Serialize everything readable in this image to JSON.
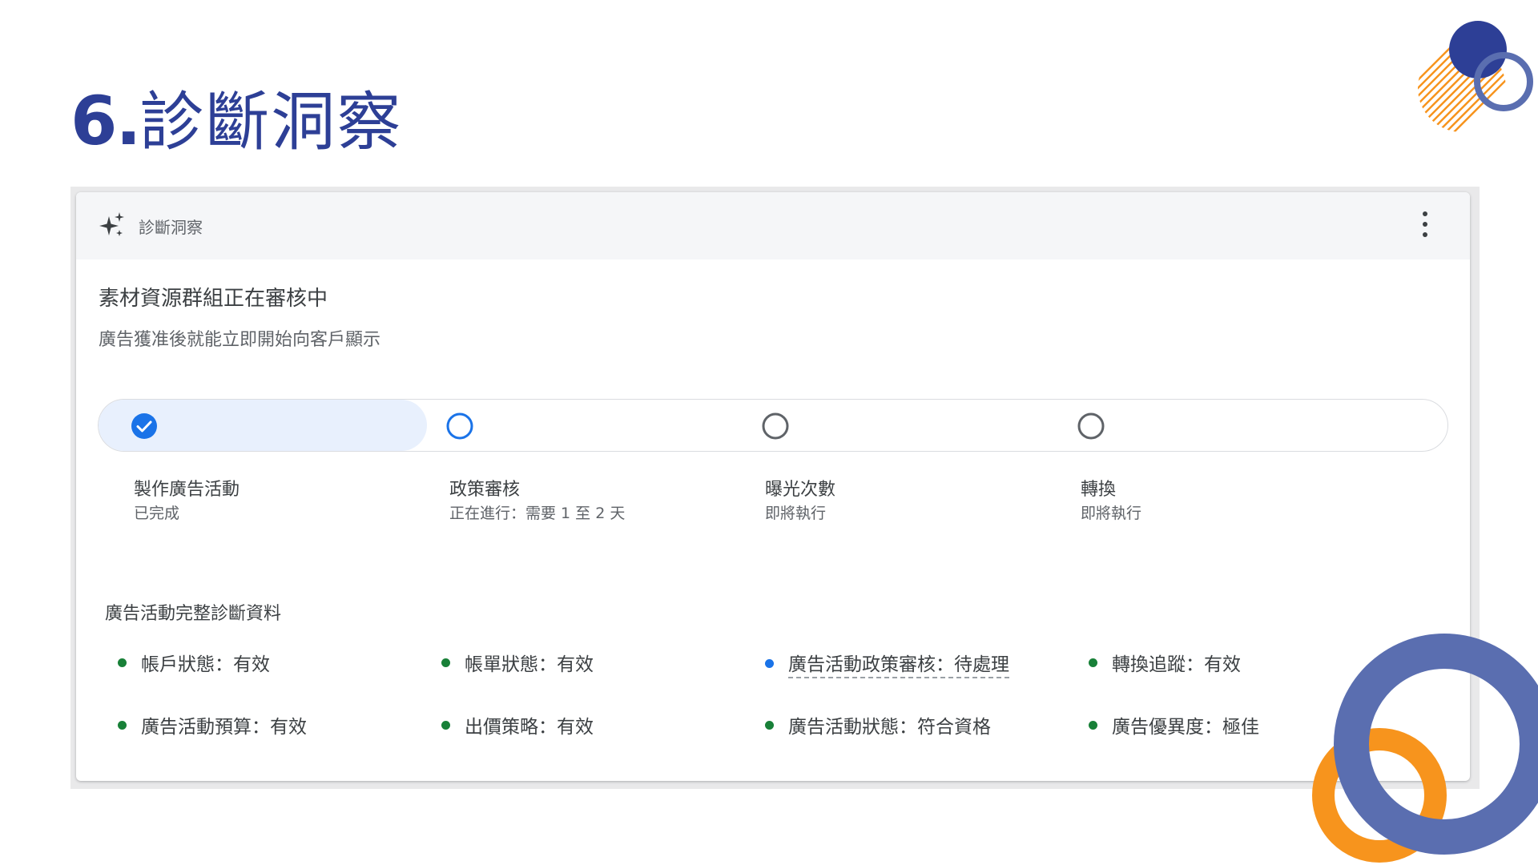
{
  "slide": {
    "number": "6.",
    "title": "診斷洞察"
  },
  "card": {
    "header_label": "診斷洞察",
    "status_title": "素材資源群組正在審核中",
    "status_subtitle": "廣告獲准後就能立即開始向客戶顯示",
    "progress": {
      "completed_steps": 1,
      "current_step": 2,
      "total_steps": 4
    },
    "steps": [
      {
        "label": "製作廣告活動",
        "status": "已完成",
        "state": "done",
        "icon": "check-circle-icon"
      },
      {
        "label": "政策審核",
        "status": "正在進行：需要 1 至 2 天",
        "state": "current",
        "icon": "circle-outline-icon"
      },
      {
        "label": "曝光次數",
        "status": "即將執行",
        "state": "pending",
        "icon": "circle-outline-icon"
      },
      {
        "label": "轉換",
        "status": "即將執行",
        "state": "pending",
        "icon": "circle-outline-icon"
      }
    ],
    "diagnostics_title": "廣告活動完整診斷資料",
    "diagnostics": [
      {
        "text": "帳戶狀態：有效",
        "status": "ok"
      },
      {
        "text": "帳單狀態：有效",
        "status": "ok"
      },
      {
        "text": "廣告活動政策審核：待處理",
        "status": "pending"
      },
      {
        "text": "轉換追蹤：有效",
        "status": "ok"
      },
      {
        "text": "廣告活動預算：有效",
        "status": "ok"
      },
      {
        "text": "出價策略：有效",
        "status": "ok"
      },
      {
        "text": "廣告活動狀態：符合資格",
        "status": "ok"
      },
      {
        "text": "廣告優異度：極佳",
        "status": "ok"
      }
    ]
  },
  "colors": {
    "title_blue": "#2d3f96",
    "google_blue": "#1a73e8",
    "status_green": "#188038",
    "deco_blue": "#5a6eb0",
    "deco_orange": "#f7941d"
  }
}
